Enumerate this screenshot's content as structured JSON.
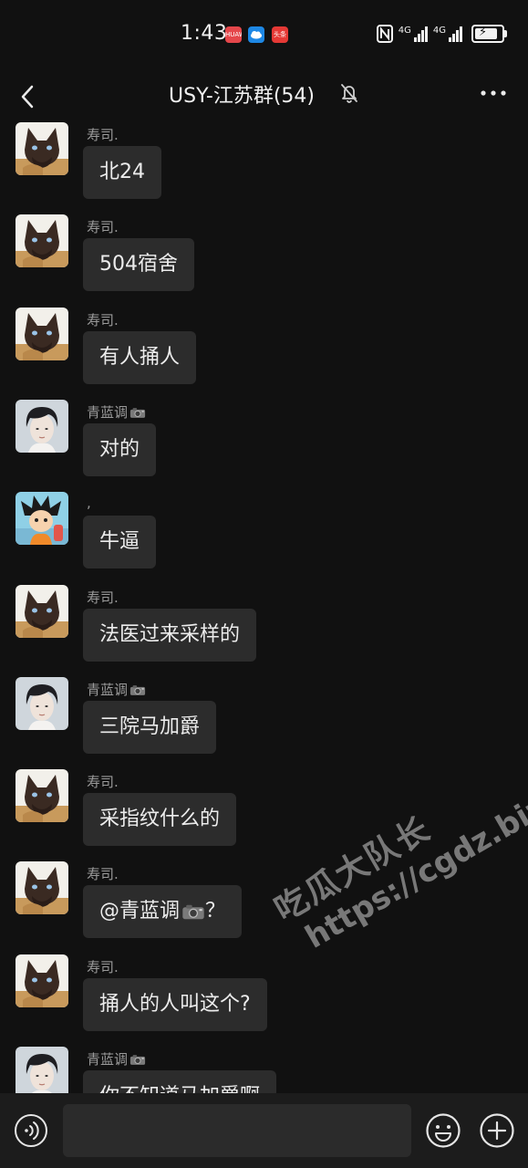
{
  "status_bar": {
    "time": "1:43",
    "app_icons": [
      "huawei-app-icon",
      "cloud-app-icon",
      "toutiao-app-icon"
    ],
    "app_icon_labels": [
      "HUAWEI",
      "",
      "头条"
    ],
    "network_labels": [
      "4G",
      "4G"
    ],
    "battery_level": 0.85
  },
  "header": {
    "title": "USY-江苏群(54)",
    "muted_icon": "bell-muted-icon",
    "back_icon": "chevron-left-icon",
    "more_icon": "more-dots-icon"
  },
  "messages": [
    {
      "sender": "寿司.",
      "avatar": "cat-avatar",
      "text": "北24",
      "camera": false
    },
    {
      "sender": "寿司.",
      "avatar": "cat-avatar",
      "text": "504宿舍",
      "camera": false
    },
    {
      "sender": "寿司.",
      "avatar": "cat-avatar",
      "text": "有人捅人",
      "camera": false
    },
    {
      "sender": "青蓝调",
      "avatar": "person-avatar",
      "text": "对的",
      "camera": false,
      "sender_camera": true
    },
    {
      "sender": ",",
      "avatar": "cartoon-avatar",
      "text": "牛逼",
      "camera": false
    },
    {
      "sender": "寿司.",
      "avatar": "cat-avatar",
      "text": "法医过来采样的",
      "camera": false
    },
    {
      "sender": "青蓝调",
      "avatar": "person-avatar",
      "text": "三院马加爵",
      "camera": false,
      "sender_camera": true
    },
    {
      "sender": "寿司.",
      "avatar": "cat-avatar",
      "text": "采指纹什么的",
      "camera": false
    },
    {
      "sender": "寿司.",
      "avatar": "cat-avatar",
      "text": "@青蓝调",
      "text_suffix": "？",
      "camera": true
    },
    {
      "sender": "寿司.",
      "avatar": "cat-avatar",
      "text": "捅人的人叫这个?",
      "camera": false
    },
    {
      "sender": "青蓝调",
      "avatar": "person-avatar",
      "text": "你不知道马加爵啊",
      "camera": false,
      "sender_camera": true
    }
  ],
  "watermark": {
    "line1": "吃瓜大队长",
    "line2": "https://cgdz.biz"
  },
  "input_bar": {
    "placeholder": "",
    "value": "",
    "voice_icon": "voice-icon",
    "emoji_icon": "emoji-icon",
    "add_icon": "plus-icon"
  },
  "colors": {
    "background": "#111111",
    "bubble": "#2c2c2c",
    "sender_name": "#9a9a9a",
    "input_bar": "#1c1c1c"
  }
}
